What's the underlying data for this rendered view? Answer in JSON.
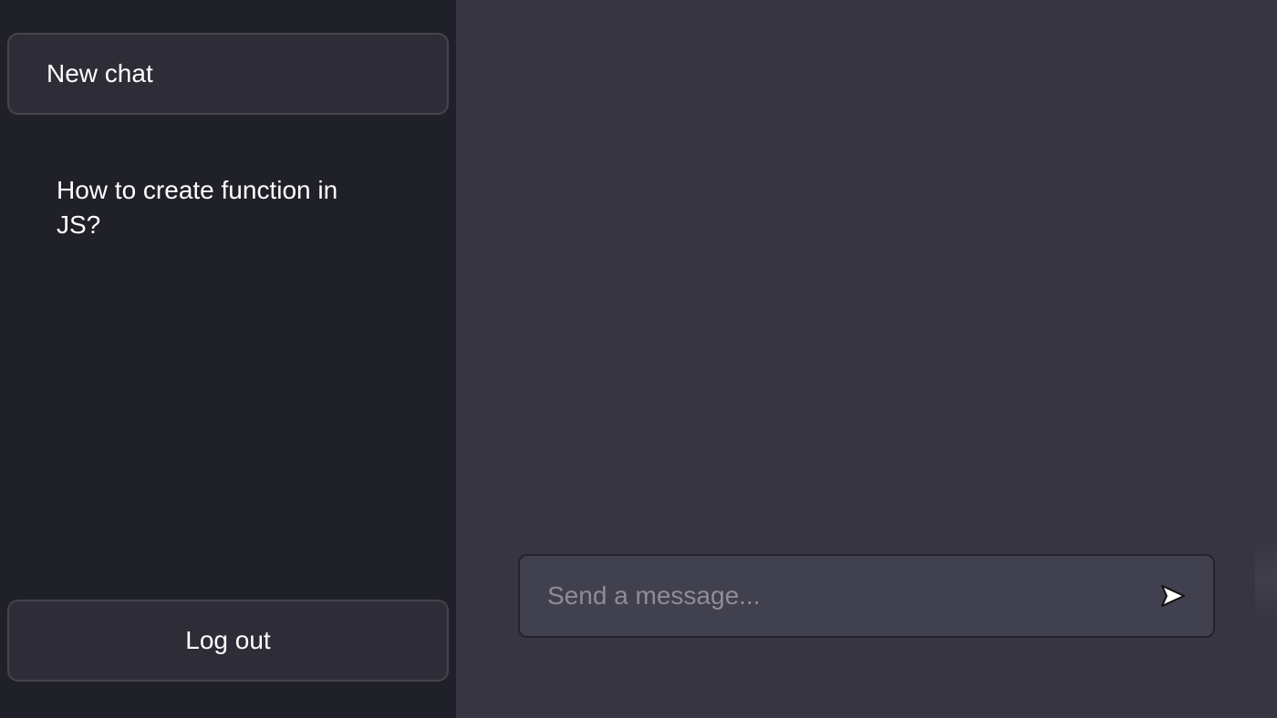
{
  "sidebar": {
    "new_chat_label": "New chat",
    "history": [
      {
        "title": "How to create function in JS?"
      }
    ],
    "logout_label": "Log out"
  },
  "composer": {
    "placeholder": "Send a message...",
    "value": "",
    "send_icon": "send-arrow-icon"
  },
  "colors": {
    "sidebar_bg": "#202029",
    "main_bg": "#363541",
    "button_bg": "#2d2c37",
    "input_bg": "#40404f"
  }
}
